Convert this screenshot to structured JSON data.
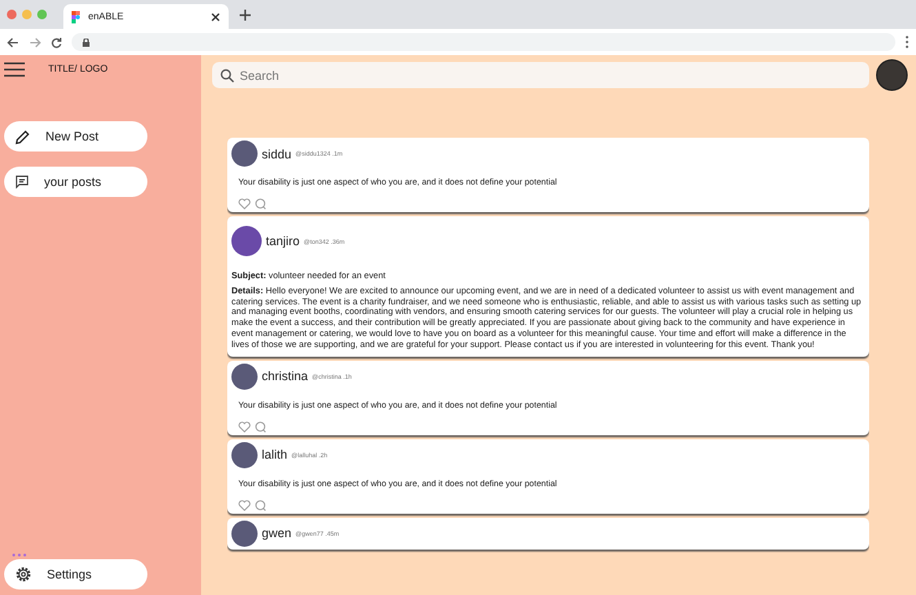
{
  "browser": {
    "tab_title": "enABLE"
  },
  "sidebar": {
    "title": "TITLE/ LOGO",
    "items": [
      {
        "label": "New Post"
      },
      {
        "label": "your posts"
      }
    ],
    "settings": "Settings"
  },
  "search": {
    "placeholder": "Search"
  },
  "posts": [
    {
      "kind": "quote",
      "name": "siddu",
      "meta": "@siddu1324 .1m",
      "body": "Your disability is just one aspect of who you are, and it does not define your potential"
    },
    {
      "kind": "announcement",
      "name": "tanjiro",
      "meta": "@ton342 .36m",
      "subject": "**Subject:** volunteer needed for an event",
      "details": "**Details:** Hello everyone! We are excited to announce our upcoming event, and we are in need of a dedicated volunteer to assist us with event management and catering services. The event is a charity fundraiser, and we need someone who is enthusiastic, reliable, and able to assist us with various tasks such as setting up and managing event booths, coordinating with vendors, and ensuring smooth catering services for our guests. The volunteer will play a crucial role in helping us make the event a success, and their contribution will be greatly appreciated. If you are passionate about giving back to the community and have experience in event management or catering, we would love to have you on board as a volunteer for this meaningful cause. Your time and effort will make a difference in the lives of those we are supporting, and we are grateful for your support. Please contact us if you are interested in volunteering for this event. Thank you!"
    },
    {
      "kind": "quote",
      "name": "christina",
      "meta": "@christina .1h",
      "body": "Your disability is just one aspect of who you are, and it does not define your potential"
    },
    {
      "kind": "quote",
      "name": "lalith",
      "meta": "@lalluhal .2h",
      "body": "Your disability is just one aspect of who you are, and it does not define your potential"
    },
    {
      "kind": "header",
      "name": "gwen",
      "meta": "@gwen77 .45m"
    }
  ]
}
